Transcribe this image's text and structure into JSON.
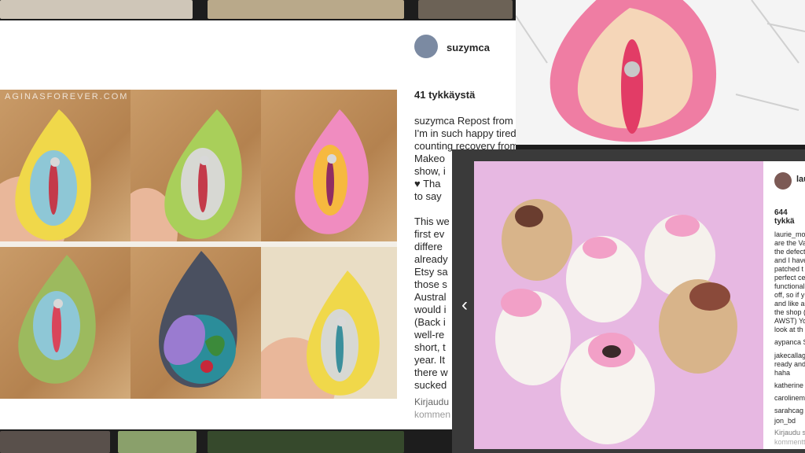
{
  "post": {
    "username": "suzymca",
    "likes": "41 tykkäystä",
    "watermark": "AGINASFOREVER.COM",
    "caption": "suzymca Repost from \nI'm in such happy tired\ncounting recovery from\nMakeo\nshow, i\n♥ Tha\nto say\n\nThis we\nfirst ev\ndiffere\nalready\nEtsy sa\nthose s\nAustral\nwould i\n(Back i\nwell-re\nshort, t\nyear. It\nthere w\nsucked",
    "login": "Kirjaudu",
    "comment": "kommen"
  },
  "overlay": {
    "username": "laurie",
    "likes": "644 tykkä",
    "caption_lines": "laurie_mo\nare the Va\nthe defect\nand I have\npatched t\nperfect ce\nfunctional\noff, so if y\nand like a\nthe shop (\nAWST) Yo\nlook at th",
    "comments": [
      "aypanca S",
      "jakecallag\nready and\nhaha",
      "katherine",
      "carolinem",
      "sarahcag",
      "jon_bd"
    ],
    "login": "Kirjaudu s",
    "comment": "kommentti",
    "prev_icon": "chevron-left-icon"
  },
  "colors": {
    "felt_yellow": "#f0d84a",
    "felt_green": "#a9cf5a",
    "felt_pink": "#f08cc0",
    "felt_olive": "#9cba5e",
    "felt_charcoal": "#4a5060",
    "background_pink": "#e7b8e2"
  }
}
